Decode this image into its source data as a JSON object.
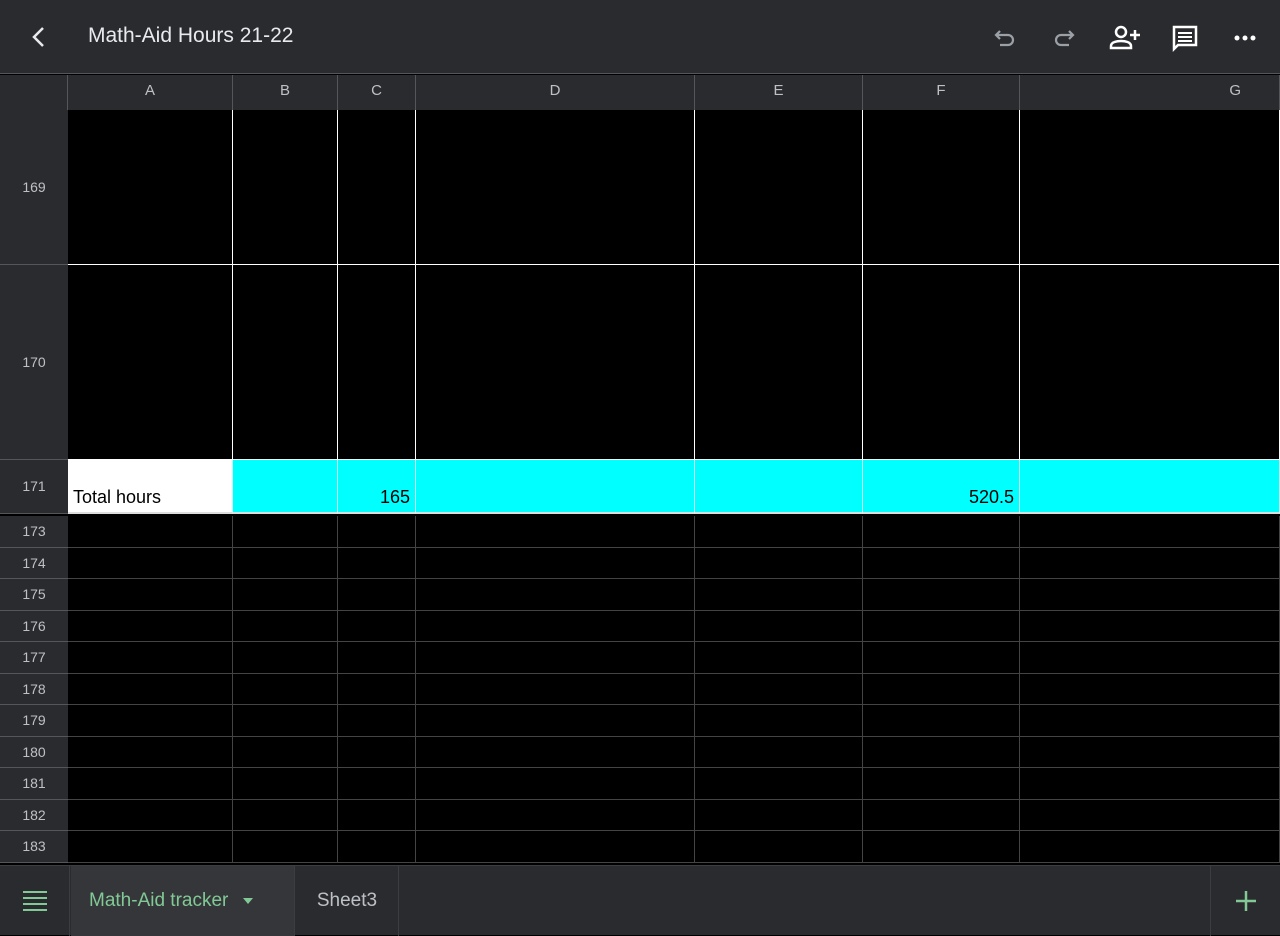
{
  "header": {
    "title": "Math-Aid Hours 21-22"
  },
  "columns": [
    "A",
    "B",
    "C",
    "D",
    "E",
    "F",
    "G"
  ],
  "rows": [
    {
      "num": "169",
      "cells": [
        "",
        "",
        "",
        "",
        "",
        "",
        ""
      ]
    },
    {
      "num": "170",
      "cells": [
        "",
        "",
        "",
        "",
        "",
        "",
        ""
      ]
    },
    {
      "num": "171",
      "cells": [
        "Total hours",
        "",
        "165",
        "",
        "",
        "520.5",
        ""
      ]
    },
    {
      "num": "173"
    },
    {
      "num": "174"
    },
    {
      "num": "175"
    },
    {
      "num": "176"
    },
    {
      "num": "177"
    },
    {
      "num": "178"
    },
    {
      "num": "179"
    },
    {
      "num": "180"
    },
    {
      "num": "181"
    },
    {
      "num": "182"
    },
    {
      "num": "183"
    }
  ],
  "tabs": [
    {
      "label": "Math-Aid tracker",
      "active": true
    },
    {
      "label": "Sheet3",
      "active": false
    }
  ],
  "colors": {
    "highlight": "#00ffff",
    "accent": "#81c995"
  }
}
